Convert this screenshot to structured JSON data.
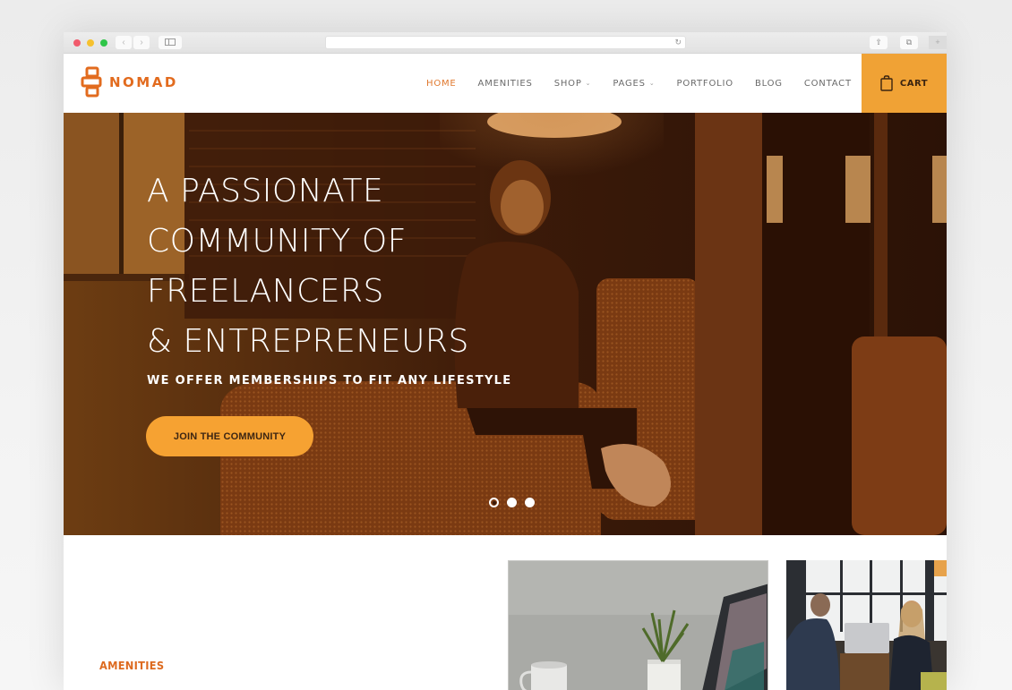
{
  "browser": {
    "url": "",
    "nav_back_icon": "chevron-left-icon",
    "nav_forward_icon": "chevron-right-icon",
    "sidebar_icon": "sidebar-icon",
    "reload_icon": "reload-icon",
    "share_icon": "share-icon",
    "tabs_icon": "tabs-icon",
    "new_tab_icon": "plus-icon"
  },
  "header": {
    "logo_text": "NOMAD",
    "nav": [
      {
        "label": "HOME",
        "active": true,
        "dropdown": false
      },
      {
        "label": "AMENITIES",
        "active": false,
        "dropdown": false
      },
      {
        "label": "SHOP",
        "active": false,
        "dropdown": true
      },
      {
        "label": "PAGES",
        "active": false,
        "dropdown": true
      },
      {
        "label": "PORTFOLIO",
        "active": false,
        "dropdown": false
      },
      {
        "label": "BLOG",
        "active": false,
        "dropdown": false
      },
      {
        "label": "CONTACT",
        "active": false,
        "dropdown": false
      }
    ],
    "dropdown_glyph": "⌄",
    "cart_label": "CART",
    "cart_icon": "shopping-bag-icon"
  },
  "hero": {
    "title_lines": [
      "A PASSIONATE",
      "COMMUNITY OF",
      "FREELANCERS",
      "& ENTREPRENEURS"
    ],
    "subtitle": "WE OFFER MEMBERSHIPS TO FIT ANY LIFESTYLE",
    "cta_label": "JOIN THE COMMUNITY",
    "slides_total": 3,
    "active_slide": 1
  },
  "amenities": {
    "label": "AMENITIES"
  },
  "colors": {
    "brand_orange": "#e26b1e",
    "cart_bg": "#f0a235",
    "cta_bg": "#f6a232",
    "nav_active": "#e0792f",
    "nav_text": "#6a6a6a"
  }
}
